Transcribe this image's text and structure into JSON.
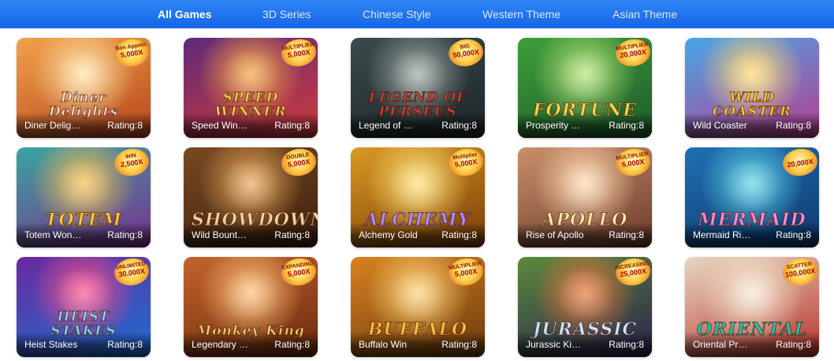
{
  "tabs": [
    {
      "label": "All Games",
      "active": true
    },
    {
      "label": "3D Series",
      "active": false
    },
    {
      "label": "Chinese Style",
      "active": false
    },
    {
      "label": "Western Theme",
      "active": false
    },
    {
      "label": "Asian Theme",
      "active": false
    }
  ],
  "games": [
    {
      "name": "Diner Delig…",
      "rating": "Rating:8",
      "logo": "Diner Delights",
      "badge_top": "Bon Appétit",
      "badge_value": "5,000X",
      "colors": [
        "#f2a24a",
        "#b5441c",
        "#ffe3a8"
      ],
      "logo_color": "#ffe8d0"
    },
    {
      "name": "Speed Win…",
      "rating": "Rating:8",
      "logo": "SPEED WINNER",
      "badge_top": "MULTIPLIER",
      "badge_value": "5,000X",
      "colors": [
        "#5e2a7a",
        "#d23a3a",
        "#f5a442"
      ],
      "logo_color": "#ffd34d"
    },
    {
      "name": "Legend of …",
      "rating": "Rating:8",
      "logo": "LEGEND OF PERSEUS",
      "badge_top": "BIG SYMBOL",
      "badge_value": "50,000X",
      "colors": [
        "#3b4a4c",
        "#1c2426",
        "#9aa7a2"
      ],
      "logo_color": "#c2453a"
    },
    {
      "name": "Prosperity …",
      "rating": "Rating:8",
      "logo": "FORTUNE",
      "badge_top": "MULTIPLIER",
      "badge_value": "20,000X",
      "colors": [
        "#3f9e3a",
        "#1d5a2a",
        "#b6e37a"
      ],
      "logo_color": "#ffd54a"
    },
    {
      "name": "Wild Coaster",
      "rating": "Rating:8",
      "logo": "WILD COASTER",
      "badge_top": "",
      "badge_value": "",
      "colors": [
        "#47a6e8",
        "#b83d8f",
        "#ffd86b"
      ],
      "logo_color": "#ffd22e"
    },
    {
      "name": "Totem Won…",
      "rating": "Rating:8",
      "logo": "TOTEM",
      "badge_top": "WIN MULTIPLIER REELS",
      "badge_value": "2,500X",
      "colors": [
        "#3aa4a0",
        "#7a2f8e",
        "#f5c04a"
      ],
      "logo_color": "#ffc83a"
    },
    {
      "name": "Wild Bount…",
      "rating": "Rating:8",
      "logo": "SHOWDOWN",
      "badge_top": "DOUBLE MULTIPLIER",
      "badge_value": "5,000X",
      "colors": [
        "#7a4a22",
        "#3b1f0e",
        "#e8a85a"
      ],
      "logo_color": "#f3d39a"
    },
    {
      "name": "Alchemy Gold",
      "rating": "Rating:8",
      "logo": "ALCHEMY",
      "badge_top": "Multiplier",
      "badge_value": "5,000X",
      "colors": [
        "#d99a22",
        "#7a3a08",
        "#ffe27a"
      ],
      "logo_color": "#b38cff"
    },
    {
      "name": "Rise of Apollo",
      "rating": "Rating:8",
      "logo": "APOLLO",
      "badge_top": "MULTIPLIER",
      "badge_value": "5,000X",
      "colors": [
        "#c98f6a",
        "#6a3a2a",
        "#ffd9b0"
      ],
      "logo_color": "#ffe7a0"
    },
    {
      "name": "Mermaid Ri…",
      "rating": "Rating:8",
      "logo": "MERMAID",
      "badge_top": "",
      "badge_value": "20,000X",
      "colors": [
        "#1f6fb3",
        "#0d3a6e",
        "#5fd3e6"
      ],
      "logo_color": "#ff8ad0"
    },
    {
      "name": "Heist Stakes",
      "rating": "Rating:8",
      "logo": "HEIST STAKES",
      "badge_top": "UNLIMITED WILD",
      "badge_value": "30,000X",
      "colors": [
        "#6a2a9e",
        "#1c6ed1",
        "#ff4f8a"
      ],
      "logo_color": "#7de3ff"
    },
    {
      "name": "Legendary …",
      "rating": "Rating:8",
      "logo": "Monkey King",
      "badge_top": "EXPANDING REELS",
      "badge_value": "5,000X",
      "colors": [
        "#c4632a",
        "#6a2a10",
        "#ffc27a"
      ],
      "logo_color": "#ffd866"
    },
    {
      "name": "Buffalo Win",
      "rating": "Rating:8",
      "logo": "BUFFALO",
      "badge_top": "MULTIPLIER",
      "badge_value": "5,000X",
      "colors": [
        "#d8821e",
        "#6a3a0e",
        "#ffd37a"
      ],
      "logo_color": "#ffbf3a"
    },
    {
      "name": "Jurassic Ki…",
      "rating": "Rating:8",
      "logo": "JURASSIC",
      "badge_top": "INCREASING MULTIPLIER",
      "badge_value": "25,000X",
      "colors": [
        "#5a8a3a",
        "#2a1f4e",
        "#e8743a"
      ],
      "logo_color": "#c9e8ff"
    },
    {
      "name": "Oriental Pr…",
      "rating": "Rating:8",
      "logo": "ORIENTAL",
      "badge_top": "SCATTER MULTIPLIER",
      "badge_value": "100,000X",
      "colors": [
        "#e6d9c2",
        "#b8322a",
        "#f5e6cf"
      ],
      "logo_color": "#2fbfa0"
    }
  ]
}
